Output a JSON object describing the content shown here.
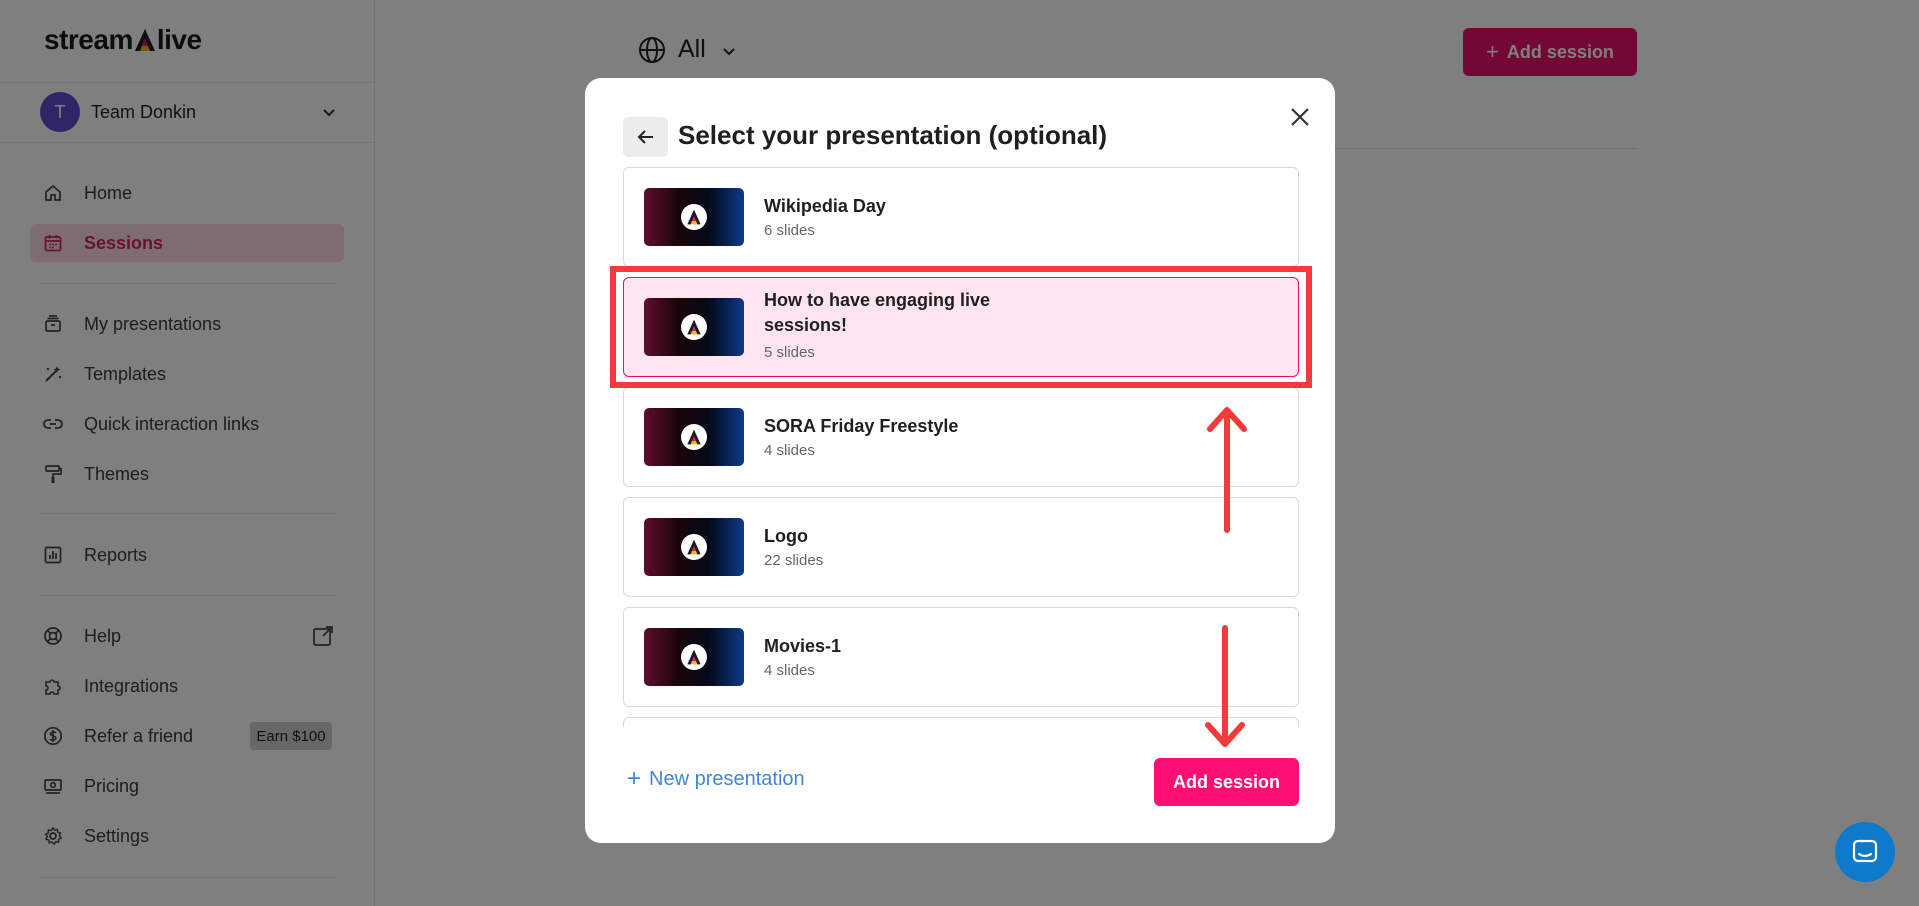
{
  "sidebar": {
    "logo_text_left": "stream",
    "logo_text_right": "live",
    "team": {
      "initial": "T",
      "name": "Team Donkin"
    },
    "items": [
      {
        "label": "Home",
        "icon": "home-icon"
      },
      {
        "label": "Sessions",
        "icon": "calendar-icon",
        "active": true
      },
      {
        "label": "My presentations",
        "icon": "presentation-stack-icon"
      },
      {
        "label": "Templates",
        "icon": "magic-wand-icon"
      },
      {
        "label": "Quick interaction links",
        "icon": "link-icon"
      },
      {
        "label": "Themes",
        "icon": "paint-roller-icon"
      },
      {
        "label": "Reports",
        "icon": "bar-chart-icon"
      },
      {
        "label": "Help",
        "icon": "lifebuoy-icon"
      },
      {
        "label": "Integrations",
        "icon": "puzzle-icon"
      },
      {
        "label": "Refer a friend",
        "icon": "dollar-circle-icon"
      },
      {
        "label": "Pricing",
        "icon": "cash-icon"
      },
      {
        "label": "Settings",
        "icon": "gear-icon"
      }
    ],
    "refer_badge": "Earn $100"
  },
  "main": {
    "filter_label": "All",
    "add_session_label": "Add session"
  },
  "modal": {
    "title": "Select your presentation (optional)",
    "presentations": [
      {
        "title": "Wikipedia Day",
        "slides": "6 slides"
      },
      {
        "title": "How to have engaging live sessions!",
        "slides": "5 slides",
        "selected": true
      },
      {
        "title": "SORA Friday Freestyle",
        "slides": "4 slides"
      },
      {
        "title": "Logo",
        "slides": "22 slides"
      },
      {
        "title": "Movies-1",
        "slides": "4 slides"
      }
    ],
    "new_presentation_label": "New presentation",
    "add_session_label": "Add session"
  },
  "colors": {
    "accent": "#ff0f74",
    "active_nav_bg": "#fbdbe6",
    "link_blue": "#3e87d6",
    "annotation_red": "#ef3b3b"
  }
}
